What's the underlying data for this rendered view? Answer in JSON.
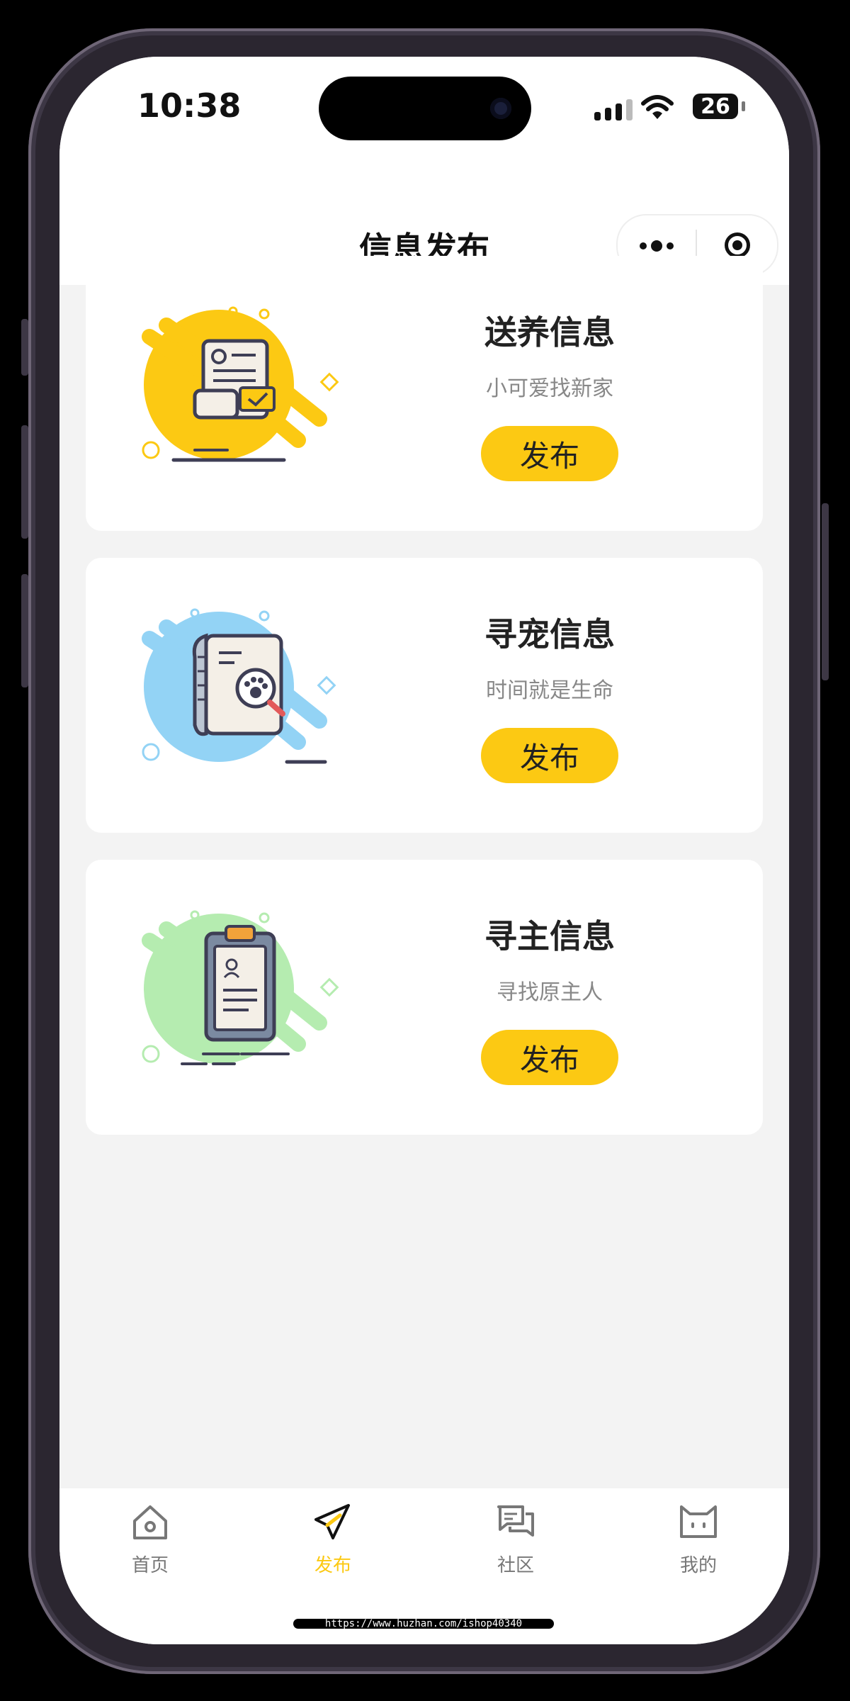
{
  "status_bar": {
    "time": "10:38",
    "battery": "26"
  },
  "nav": {
    "title": "信息发布"
  },
  "cards": [
    {
      "title": "送养信息",
      "subtitle": "小可爱找新家",
      "button": "发布",
      "icon": "adoption-document-icon",
      "color": "#fcc913"
    },
    {
      "title": "寻宠信息",
      "subtitle": "时间就是生命",
      "button": "发布",
      "icon": "lost-pet-search-icon",
      "color": "#93d3f5"
    },
    {
      "title": "寻主信息",
      "subtitle": "寻找原主人",
      "button": "发布",
      "icon": "clipboard-owner-icon",
      "color": "#b5ecb0"
    }
  ],
  "tabbar": {
    "items": [
      {
        "label": "首页",
        "icon": "home-icon",
        "active": false
      },
      {
        "label": "发布",
        "icon": "paper-plane-icon",
        "active": true
      },
      {
        "label": "社区",
        "icon": "chat-bubbles-icon",
        "active": false
      },
      {
        "label": "我的",
        "icon": "cat-face-icon",
        "active": false
      }
    ]
  },
  "watermark": "https://www.huzhan.com/ishop40340",
  "colors": {
    "accent": "#fcc913",
    "background": "#f3f3f3",
    "active_tab": "#fcc913",
    "inactive_tab": "#777777"
  }
}
